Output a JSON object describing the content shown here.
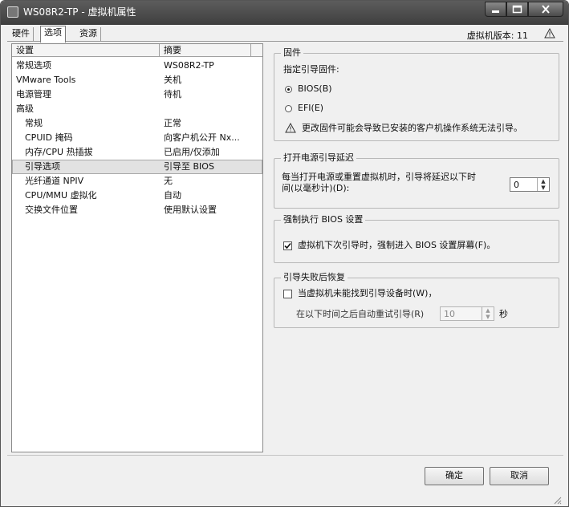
{
  "window": {
    "title": "WS08R2-TP - 虚拟机属性"
  },
  "tabs": [
    {
      "label": "硬件"
    },
    {
      "label": "选项"
    },
    {
      "label": "资源"
    }
  ],
  "version_text": "虚拟机版本: 11",
  "list": {
    "headers": {
      "setting": "设置",
      "summary": "摘要"
    },
    "rows": [
      {
        "name": "常规选项",
        "value": "WS08R2-TP"
      },
      {
        "name": "VMware Tools",
        "value": "关机"
      },
      {
        "name": "电源管理",
        "value": "待机"
      },
      {
        "name": "高级",
        "value": ""
      },
      {
        "name": "常规",
        "value": "正常"
      },
      {
        "name": "CPUID 掩码",
        "value": "向客户机公开 Nx..."
      },
      {
        "name": "内存/CPU 热插拔",
        "value": "已启用/仅添加"
      },
      {
        "name": "引导选项",
        "value": "引导至 BIOS"
      },
      {
        "name": "光纤通道 NPIV",
        "value": "无"
      },
      {
        "name": "CPU/MMU 虚拟化",
        "value": "自动"
      },
      {
        "name": "交换文件位置",
        "value": "使用默认设置"
      }
    ]
  },
  "firmware": {
    "title": "固件",
    "prompt": "指定引导固件:",
    "bios_label": "BIOS(B)",
    "efi_label": "EFI(E)",
    "selected": "BIOS",
    "warning": "更改固件可能会导致已安装的客户机操作系统无法引导。"
  },
  "boot_delay": {
    "title": "打开电源引导延迟",
    "desc_line1": "每当打开电源或重置虚拟机时，引导将延迟以下时",
    "desc_line2": "间(以毫秒计)(D):",
    "value": "0"
  },
  "force_bios": {
    "title": "强制执行 BIOS 设置",
    "label": "虚拟机下次引导时，强制进入 BIOS 设置屏幕(F)。",
    "checked": true
  },
  "boot_recovery": {
    "title": "引导失败后恢复",
    "label": "当虚拟机未能找到引导设备时(W)，",
    "retry_label": "在以下时间之后自动重试引导(R)",
    "retry_value": "10",
    "unit": "秒",
    "checked": false
  },
  "buttons": {
    "ok": "确定",
    "cancel": "取消"
  }
}
